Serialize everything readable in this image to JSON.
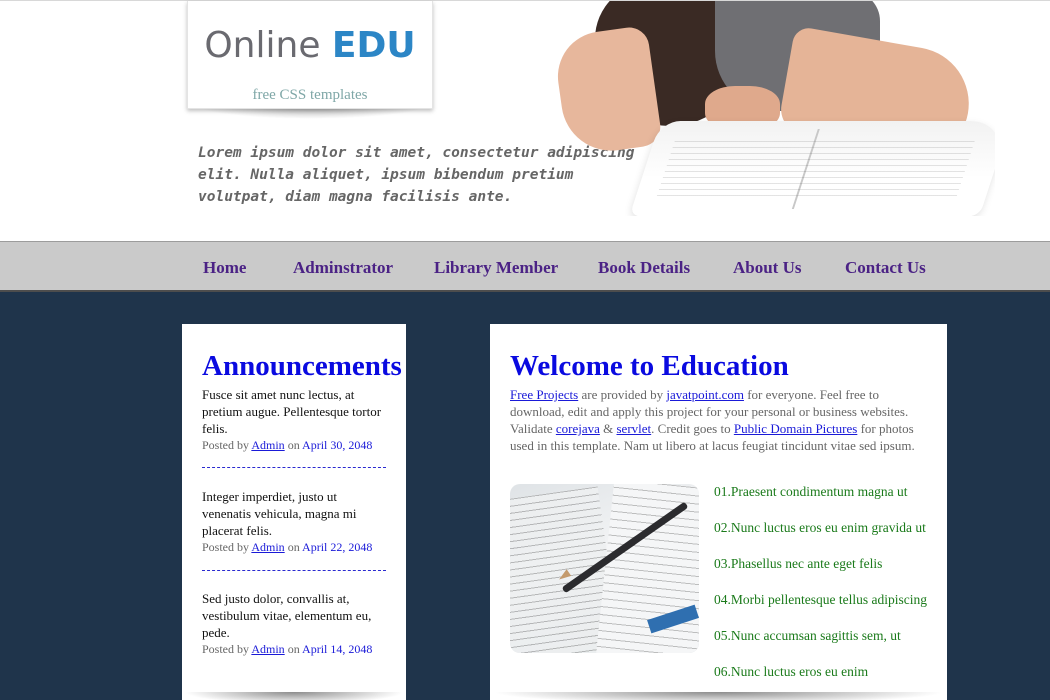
{
  "header": {
    "logo_main": "Online ",
    "logo_accent": "EDU",
    "logo_sub": "free CSS templates",
    "tagline": "Lorem ipsum dolor sit amet, consectetur adipiscing elit. Nulla aliquet, ipsum bibendum pretium volutpat, diam magna facilisis ante."
  },
  "nav": {
    "items": [
      "Home",
      "Adminstrator",
      "Library Member",
      "Book Details",
      "About Us",
      "Contact Us"
    ]
  },
  "announcements": {
    "title": "Announcements",
    "items": [
      {
        "text": "Fusce sit amet nunc lectus, at pretium augue. Pellentesque tortor felis.",
        "posted_by": "Posted by ",
        "author": "Admin",
        "on": " on ",
        "date": "April 30, 2048"
      },
      {
        "text": "Integer imperdiet, justo ut venenatis vehicula, magna mi placerat felis.",
        "posted_by": "Posted by ",
        "author": "Admin",
        "on": " on ",
        "date": "April 22, 2048"
      },
      {
        "text": "Sed justo dolor, convallis at, vestibulum vitae, elementum eu, pede.",
        "posted_by": "Posted by ",
        "author": "Admin",
        "on": " on ",
        "date": "April 14, 2048"
      }
    ]
  },
  "welcome": {
    "title": "Welcome to Education",
    "intro": {
      "link1": "Free Projects",
      "t1": " are provided by ",
      "link2": "javatpoint.com",
      "t2": " for everyone. Feel free to download, edit and apply this project for your personal or business websites. Validate ",
      "link3": "corejava",
      "t3": " & ",
      "link4": "servlet",
      "t4": ". Credit goes to ",
      "link5": "Public Domain Pictures",
      "t5": " for photos used in this template. Nam ut libero at lacus feugiat tincidunt vitae sed ipsum."
    },
    "list": [
      "01.Praesent condimentum magna ut",
      "02.Nunc luctus eros eu enim gravida ut",
      "03.Phasellus nec ante eget felis",
      "04.Morbi pellentesque tellus adipiscing",
      "05.Nunc accumsan sagittis sem, ut",
      "06.Nunc luctus eros eu enim"
    ]
  },
  "colors": {
    "nav_text": "#4b2285",
    "main_bg": "#1f344b",
    "heading": "#0a0ae0",
    "list_text": "#1a7a1a",
    "logo_accent": "#2c86c6"
  }
}
